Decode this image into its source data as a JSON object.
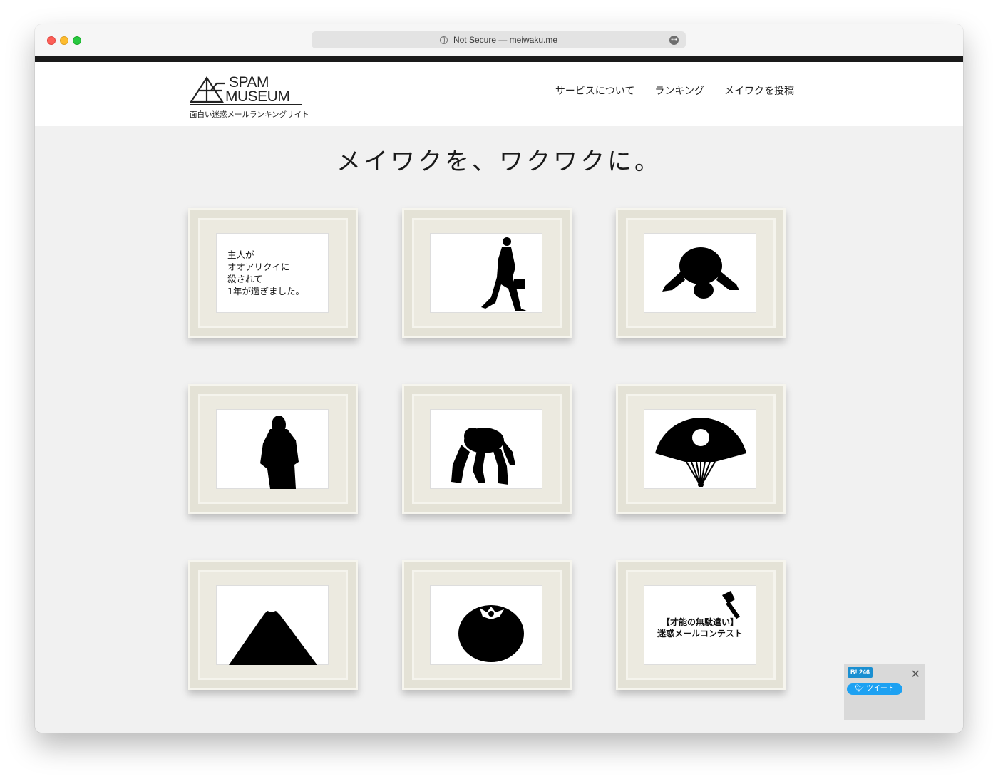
{
  "browser": {
    "url_text": "Not Secure — meiwaku.me"
  },
  "site": {
    "logo_line1": "SPAM",
    "logo_line2": "MUSEUM",
    "tagline": "面白い迷惑メールランキングサイト"
  },
  "nav": {
    "items": [
      "サービスについて",
      "ランキング",
      "メイワクを投稿"
    ]
  },
  "hero": {
    "title": "メイワクを、ワクワクに。"
  },
  "frames": [
    {
      "text": "主人が\nオオアリクイに\n殺されて\n1年が過ぎました。",
      "icon": "text-panel"
    },
    {
      "icon": "walking-businessman-icon"
    },
    {
      "icon": "kneeling-bow-icon"
    },
    {
      "icon": "standing-woman-icon"
    },
    {
      "icon": "chimpanzee-icon"
    },
    {
      "icon": "folding-fan-icon"
    },
    {
      "icon": "mount-fuji-icon"
    },
    {
      "icon": "persimmon-icon"
    },
    {
      "text": "【才能の無駄遣い】\n迷惑メールコンテスト",
      "icon": "paintbrush-icon"
    }
  ],
  "share": {
    "hatena_label": "B! 246",
    "tweet_label": "ツイート",
    "close_symbol": "✕"
  }
}
